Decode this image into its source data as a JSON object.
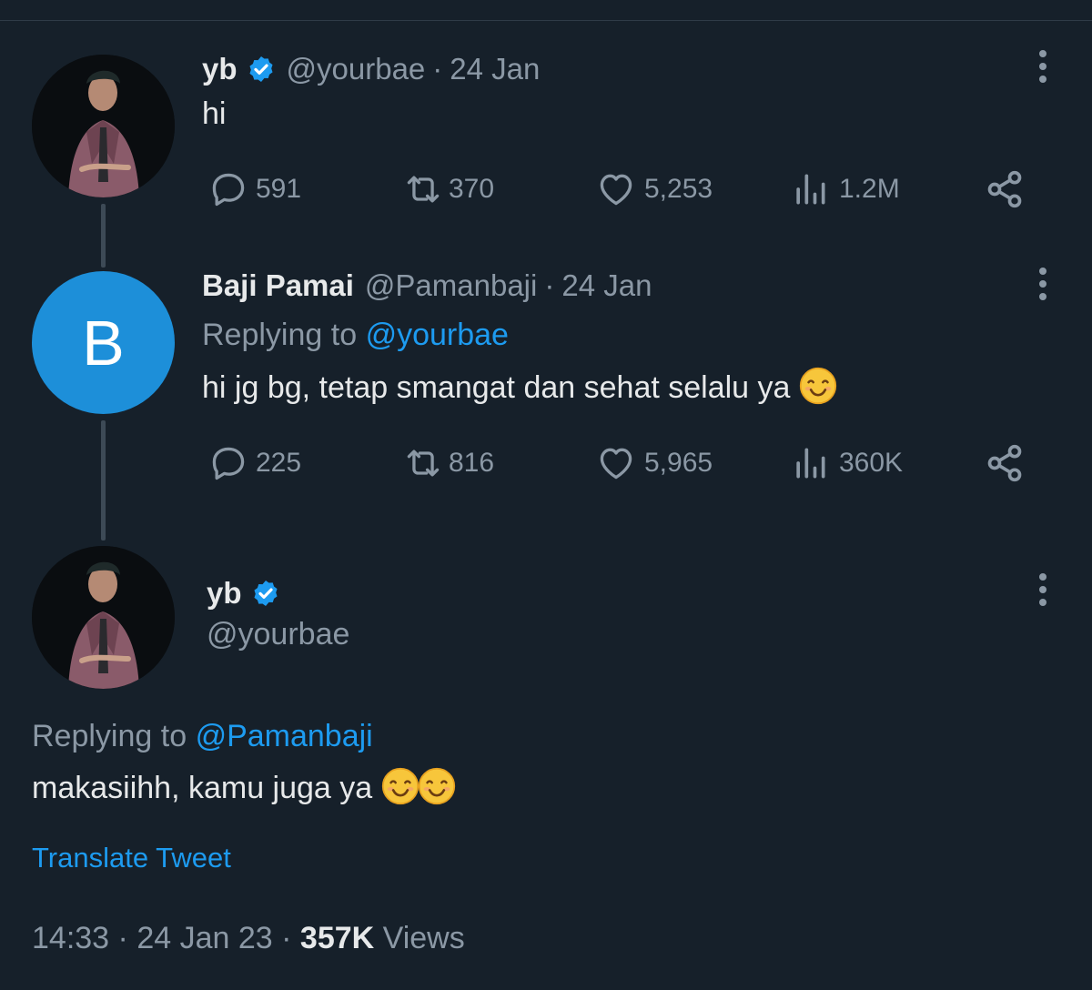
{
  "tweets": [
    {
      "name": "yb",
      "handle": "@yourbae",
      "sep": "·",
      "date": "24 Jan",
      "text": "hi",
      "replies": "591",
      "retweets": "370",
      "likes": "5,253",
      "views": "1.2M"
    },
    {
      "avatar_letter": "B",
      "name": "Baji Pamai",
      "handle": "@Pamanbaji",
      "sep": "·",
      "date": "24 Jan",
      "replying_prefix": "Replying to",
      "replying_to": "@yourbae",
      "text": "hi jg bg, tetap smangat dan sehat selalu ya",
      "replies": "225",
      "retweets": "816",
      "likes": "5,965",
      "views": "360K"
    },
    {
      "name": "yb",
      "handle": "@yourbae",
      "replying_prefix": "Replying to",
      "replying_to": "@Pamanbaji",
      "text": "makasiihh, kamu juga ya",
      "translate": "Translate Tweet",
      "time": "14:33",
      "sep": "·",
      "full_date": "24 Jan 23",
      "views_count": "357K",
      "views_label": "Views"
    }
  ],
  "colors": {
    "background": "#16202a",
    "accent": "#1d9bf0",
    "muted": "#8b98a5",
    "avatar_b": "#1d8fd9"
  },
  "icons": [
    "verified-badge-icon",
    "reply-icon",
    "retweet-icon",
    "like-icon",
    "views-icon",
    "share-icon",
    "more-icon",
    "smiling-face-emoji"
  ]
}
